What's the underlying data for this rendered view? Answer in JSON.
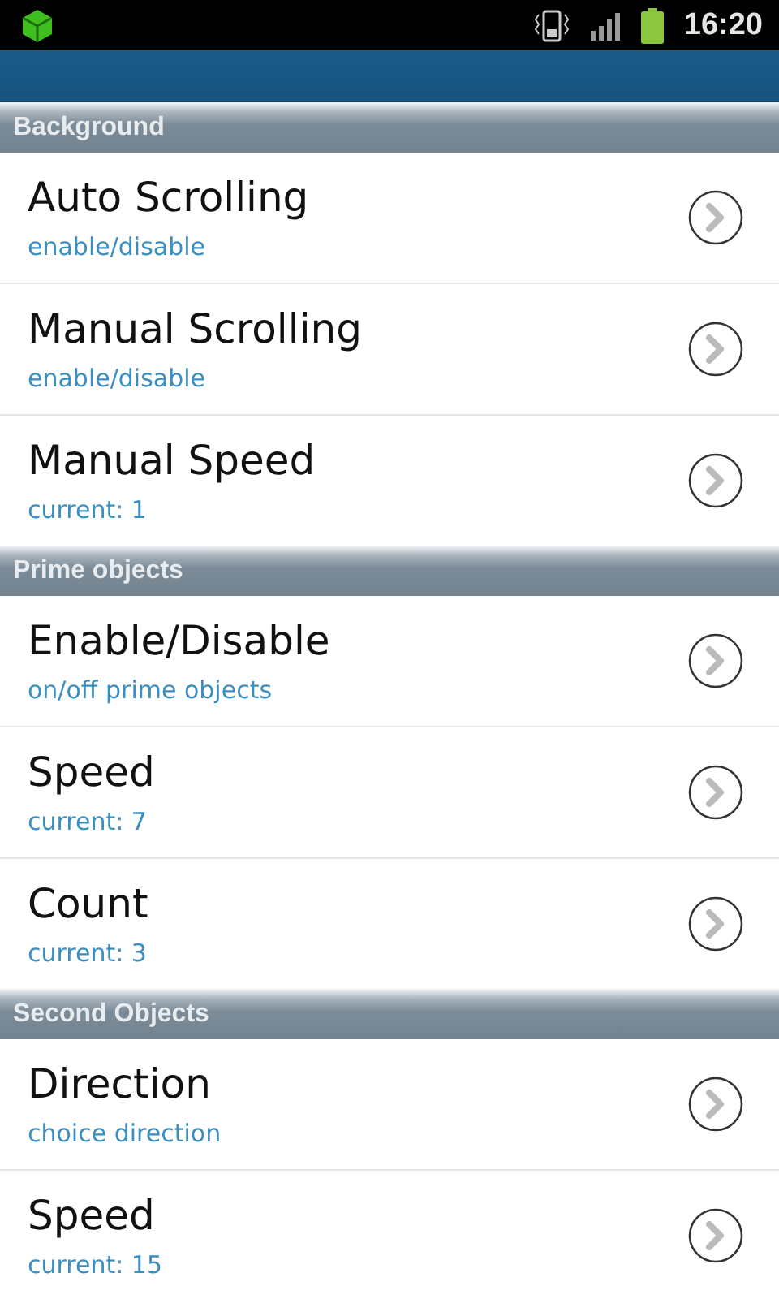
{
  "status_bar": {
    "time": "16:20"
  },
  "sections": [
    {
      "title": "Background",
      "items": [
        {
          "title": "Auto Scrolling",
          "summary": "enable/disable"
        },
        {
          "title": "Manual Scrolling",
          "summary": "enable/disable"
        },
        {
          "title": "Manual Speed",
          "summary": "current: 1"
        }
      ]
    },
    {
      "title": "Prime objects",
      "items": [
        {
          "title": "Enable/Disable",
          "summary": "on/off prime objects"
        },
        {
          "title": "Speed",
          "summary": "current: 7"
        },
        {
          "title": "Count",
          "summary": "current: 3"
        }
      ]
    },
    {
      "title": "Second Objects",
      "items": [
        {
          "title": "Direction",
          "summary": "choice direction"
        },
        {
          "title": "Speed",
          "summary": "current: 15"
        }
      ]
    }
  ]
}
